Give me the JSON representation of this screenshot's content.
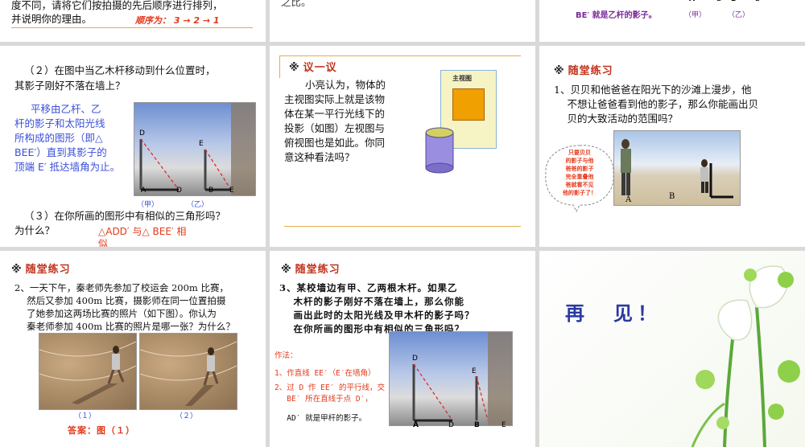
{
  "s1": {
    "line1": "度不同，请将它们按拍摄的先后顺序进行排列，",
    "line2": "并说明你的理由。",
    "answer": "顺序为： 3 → 2 → 1"
  },
  "s2": {
    "text": "之比。"
  },
  "s3": {
    "labels": [
      "A",
      "D",
      "B",
      "E"
    ],
    "caption": "BE′ 就是乙杆的影子。",
    "jia": "（甲）",
    "yi": "（乙）"
  },
  "s4": {
    "q2_line1": "（２）在图中当乙木杆移动到什么位置时，",
    "q2_line2": "其影子刚好不落在墙上？",
    "ans": [
      "平移由乙杆、乙",
      "杆的影子和太阳光线",
      "所构成的图形（即△",
      "BEE′）直到其影子的",
      "顶端 E′ 抵达墙角为止。"
    ],
    "fig_labels": {
      "D": "D",
      "E": "E",
      "A": "A",
      "D2": "D",
      "B": "B",
      "E2": "E"
    },
    "jia": "（甲）",
    "yi": "（乙）",
    "q3_line1": "（３）在你所画的图形中有相似的三角形吗？",
    "q3_line2": "为什么？",
    "q3_ans1": "△ADD′ 与△ BEE′ 相",
    "q3_ans2": "似"
  },
  "s5": {
    "header": "议一议",
    "lines": [
      "小亮认为，物体的",
      "主视图实际上就是该物",
      "体在某一平行光线下的",
      "投影（如图）左视图与",
      "俯视图也是如此。你同",
      "意这种看法吗？"
    ],
    "card_title": "主视图"
  },
  "s6": {
    "header": "随堂练习",
    "lines": [
      "1、贝贝和他爸爸在阳光下的沙滩上漫步，他",
      "　 不想让爸爸看到他的影子，那么你能画出贝",
      "　 贝的大致活动的范围吗？"
    ],
    "bubble": [
      "只要贝贝",
      "的影子与他",
      "爸爸的影子",
      "完全重叠他",
      "爸就看不见",
      "他的影子了！"
    ],
    "A": "A",
    "B": "B"
  },
  "s7": {
    "header": "随堂练习",
    "lines": [
      "2、一天下午，秦老师先参加了校运会 200m 比赛，",
      "　 然后又参加 400m 比赛，摄影师在同一位置拍摄",
      "　 了她参加这两场比赛的照片（如下图）。你认为",
      "　 秦老师参加 400m 比赛的照片是哪一张？为什么？"
    ],
    "cap1": "（１）",
    "cap2": "（２）",
    "answer": "答案：图（１）"
  },
  "s8": {
    "header": "随堂练习",
    "lines": [
      "3、某校墙边有甲、乙两根木杆。如果乙",
      "　 木杆的影子刚好不落在墙上，那么你能",
      "　 画出此时的太阳光线及甲木杆的影子吗？",
      "　 在你所画的图形中有相似的三角形吗？"
    ],
    "method": "作法：",
    "steps": [
      "1、作直线 EE′（E′在墙角）",
      "2、过 D 作 EE′ 的平行线，交",
      "　 BE′ 所在直线于点 D′，",
      "　 AD′ 就是甲杆的影子。"
    ],
    "fig": {
      "D": "D",
      "E": "E",
      "A": "A",
      "D2": "D",
      "B": "B",
      "E2": "E"
    }
  },
  "s9": {
    "text": "再　见！"
  }
}
